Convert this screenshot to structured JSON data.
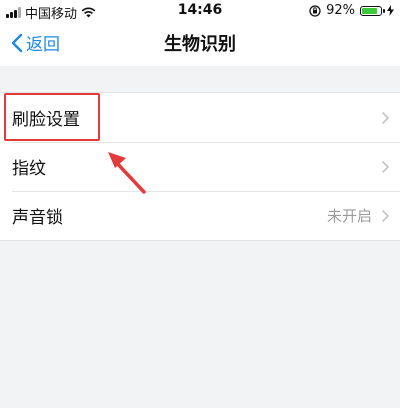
{
  "status_bar": {
    "carrier": "中国移动",
    "time": "14:46",
    "battery_percent_label": "92%",
    "battery_level": 0.92,
    "icons": [
      "signal-icon",
      "wifi-icon",
      "orientation-lock-icon",
      "battery-icon",
      "charging-bolt-icon"
    ]
  },
  "nav": {
    "back_label": "返回",
    "title": "生物识别"
  },
  "settings": {
    "items": [
      {
        "label": "刷脸设置",
        "value": ""
      },
      {
        "label": "指纹",
        "value": ""
      },
      {
        "label": "声音锁",
        "value": "未开启"
      }
    ]
  },
  "annotation": {
    "highlight_color": "#e23b3b",
    "arrow_color": "#e23b3b"
  },
  "colors": {
    "accent": "#1e88e5",
    "background": "#f2f3f5",
    "battery": "#3cc93c"
  }
}
